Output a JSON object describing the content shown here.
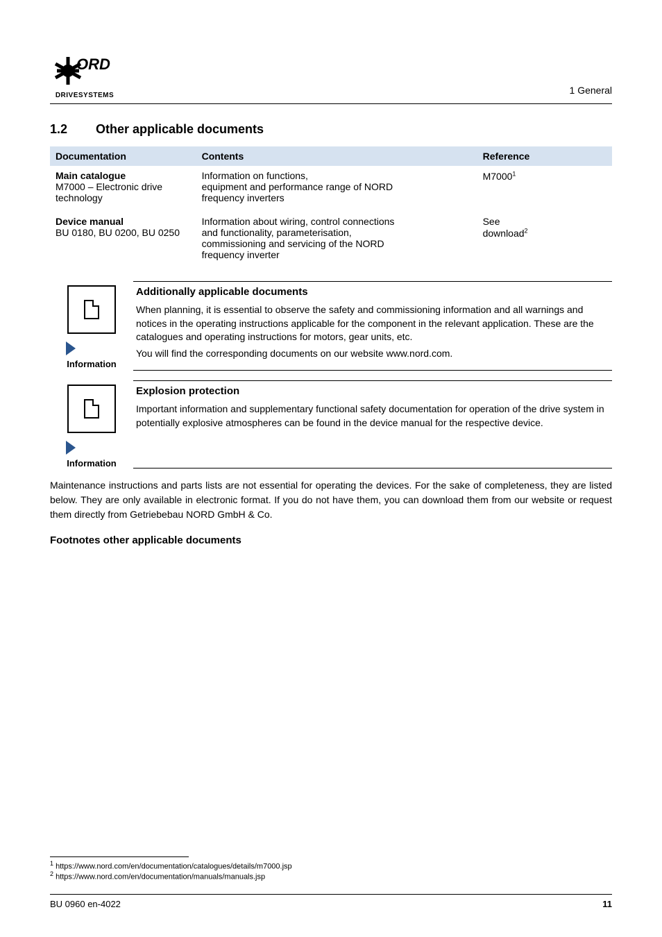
{
  "logo": {
    "brand": "NORD",
    "tagline": "DRIVESYSTEMS"
  },
  "breadcrumb": "1 General",
  "section": {
    "number": "1.2",
    "title": "Other applicable documents"
  },
  "table": {
    "headers": {
      "doc": "Documentation",
      "contents": "Contents",
      "ref": "Reference"
    },
    "rows": [
      {
        "doc_title": "Main catalogue",
        "doc_sub": "M7000 – Electronic drive technology",
        "contents": "Information on functions,\nequipment and performance range of NORD\nfrequency inverters",
        "ref_label": "M7000",
        "ref_sup": "1"
      },
      {
        "doc_title": "Device manual",
        "doc_sub": "BU 0180, BU 0200, BU 0250",
        "contents": "Information about wiring, control connections\nand functionality, parameterisation,\ncommissioning and servicing of the NORD\nfrequency inverter",
        "ref_label": "See\ndownload",
        "ref_sup": "2"
      }
    ]
  },
  "info_boxes": [
    {
      "title": "Additionally applicable documents",
      "lines": [
        "When planning, it is essential to observe the safety and commissioning information and all warnings and notices in the operating instructions applicable for the component in the relevant application. These are the catalogues and operating instructions for motors, gear units, etc.",
        "You will find the corresponding documents on our website www.nord.com."
      ],
      "icon_caption": "Information",
      "icon_style": "info"
    },
    {
      "title": "Explosion protection",
      "lines": [
        "Important information and supplementary functional safety documentation for operation of the drive system in potentially explosive atmospheres can be found in the device manual for the respective device."
      ],
      "icon_caption": "Information",
      "icon_style": "info"
    }
  ],
  "body_paragraph": "Maintenance instructions and parts lists are not essential for operating the devices. For the sake of completeness, they are listed below. They are only available in electronic format. If you do not have them, you can download them from our website or request them directly from Getriebebau NORD GmbH & Co.",
  "footnotes_heading": "Footnotes other applicable documents",
  "footnotes": [
    {
      "num": "1",
      "url": "https://www.nord.com/en/documentation/catalogues/details/m7000.jsp"
    },
    {
      "num": "2",
      "url": "https://www.nord.com/en/documentation/manuals/manuals.jsp"
    }
  ],
  "footer": {
    "left": "BU 0960 en-4022",
    "right": "11"
  }
}
